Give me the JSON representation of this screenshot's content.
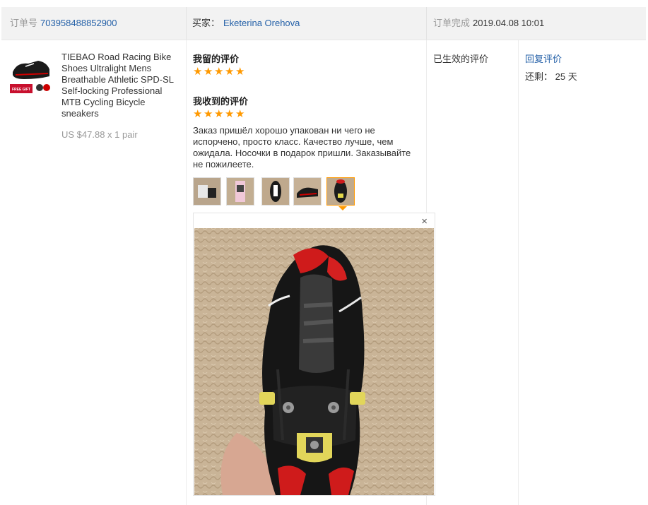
{
  "order": {
    "number_label": "订单号",
    "number_value": "703958488852900",
    "buyer_label": "买家：",
    "buyer_name": "Eketerina Orehova",
    "complete_label": "订单完成",
    "complete_time": "2019.04.08 10:01"
  },
  "product": {
    "thumb_badge": "FREE GIFT",
    "title": "TIEBAO Road Racing Bike Shoes Ultralight Mens Breathable Athletic SPD-SL Self-locking Professional MTB Cycling Bicycle sneakers",
    "price": "US $47.88 x 1 pair"
  },
  "feedback": {
    "left_title": "我留的评价",
    "left_stars": 5,
    "received_title": "我收到的评价",
    "received_stars": 5,
    "review_text": "Заказ пришёл хорошо упакован ни чего не испорчено, просто класс. Качество лучше, чем ожидала. Носочки в подарок пришли. Заказывайте не пожилеете.",
    "photos": [
      "photo-1",
      "photo-2",
      "photo-3",
      "photo-4",
      "photo-5"
    ],
    "active_photo_index": 4,
    "close_symbol": "×"
  },
  "status": {
    "text": "已生效的评价"
  },
  "actions": {
    "reply_label": "回复评价",
    "remaining_label": "还剩：",
    "remaining_value": "25 天"
  },
  "colors": {
    "link": "#2561a8",
    "star": "#ff9900",
    "header_bg": "#f2f2f2"
  }
}
